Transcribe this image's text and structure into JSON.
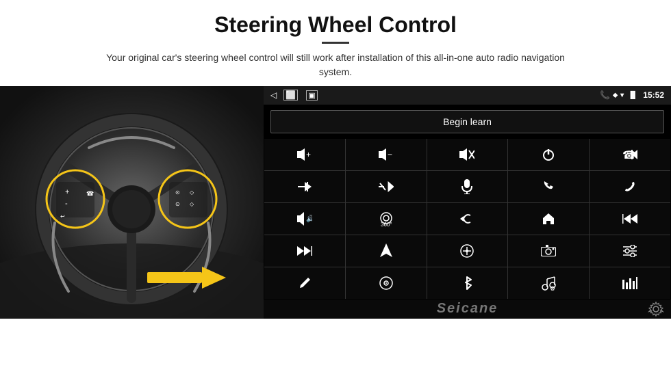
{
  "header": {
    "title": "Steering Wheel Control",
    "subtitle": "Your original car's steering wheel control will still work after installation of this all-in-one auto radio navigation system."
  },
  "android_panel": {
    "status_bar": {
      "time": "15:52",
      "nav_back": "◁",
      "nav_home": "□",
      "nav_recent": "□"
    },
    "begin_learn_label": "Begin learn"
  },
  "controls": [
    {
      "row": 1,
      "icons": [
        "vol+",
        "vol-",
        "mute",
        "power",
        "prev-track"
      ]
    },
    {
      "row": 2,
      "icons": [
        "next",
        "shuffle",
        "mic",
        "phone",
        "hangup"
      ]
    },
    {
      "row": 3,
      "icons": [
        "speaker",
        "360cam",
        "back",
        "home",
        "skip-back"
      ]
    },
    {
      "row": 4,
      "icons": [
        "skip-fwd",
        "navigate",
        "eq",
        "camera",
        "settings-sliders"
      ]
    },
    {
      "row": 5,
      "icons": [
        "pen",
        "disc",
        "bluetooth",
        "music",
        "equalizer"
      ]
    }
  ],
  "watermark": {
    "logo": "Seicane"
  },
  "colors": {
    "background": "#ffffff",
    "panel_bg": "#000000",
    "status_bg": "#1a1a1a",
    "btn_bg": "#0a0a0a",
    "grid_gap": "#333333",
    "text_primary": "#ffffff",
    "circle_highlight": "#f5c518"
  }
}
